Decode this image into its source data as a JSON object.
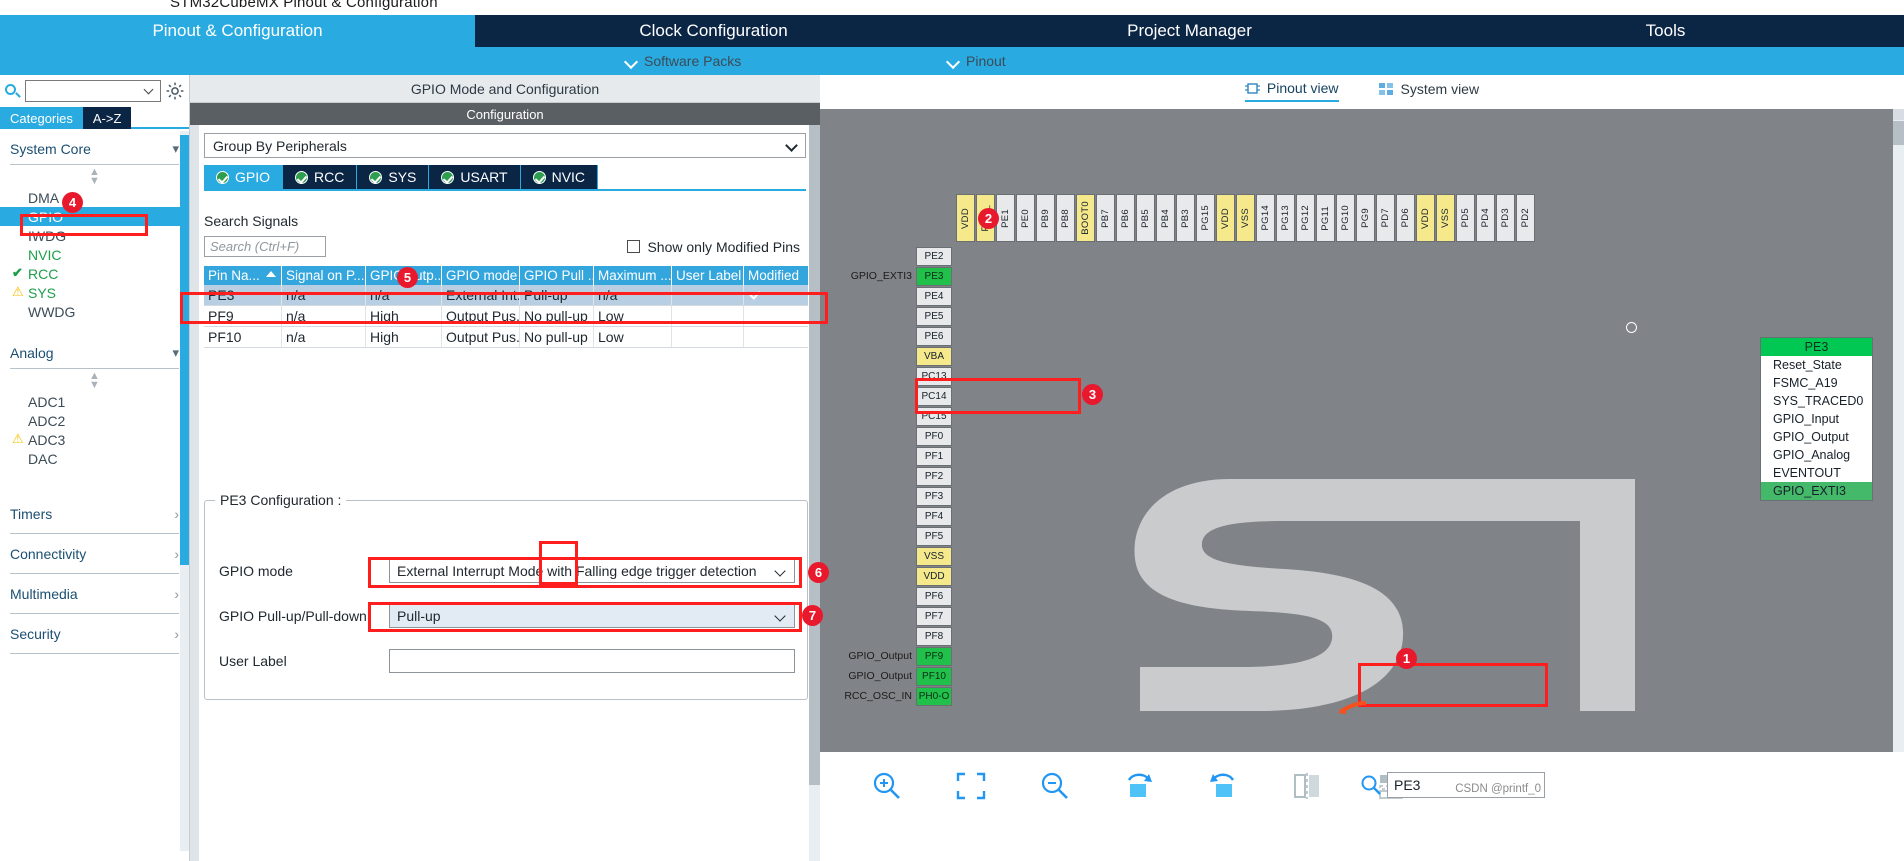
{
  "window": {
    "title_fragment": "STM32CubeMX Pinout & Configuration"
  },
  "main_tabs": [
    {
      "label": "Pinout & Configuration",
      "active": true
    },
    {
      "label": "Clock Configuration",
      "active": false
    },
    {
      "label": "Project Manager",
      "active": false
    },
    {
      "label": "Tools",
      "active": false
    }
  ],
  "sub_bar": {
    "software_packs": "Software Packs",
    "pinout": "Pinout",
    "chevron_icon": "chevron-down-icon"
  },
  "sidebar": {
    "search_placeholder": "",
    "search_icon": "search-icon",
    "settings_icon": "gear-icon",
    "tabs": [
      {
        "label": "Categories",
        "active": true
      },
      {
        "label": "A->Z",
        "active": false
      }
    ],
    "sections": [
      {
        "title": "System Core",
        "expanded": true,
        "items": [
          {
            "label": "DMA",
            "status": "none",
            "selected": false
          },
          {
            "label": "GPIO",
            "status": "none",
            "selected": true
          },
          {
            "label": "IWDG",
            "status": "none",
            "selected": false
          },
          {
            "label": "NVIC",
            "status": "configured",
            "selected": false
          },
          {
            "label": "RCC",
            "status": "ok",
            "selected": false
          },
          {
            "label": "SYS",
            "status": "warning",
            "selected": false
          },
          {
            "label": "WWDG",
            "status": "none",
            "selected": false
          }
        ]
      },
      {
        "title": "Analog",
        "expanded": true,
        "items": [
          {
            "label": "ADC1",
            "status": "none",
            "selected": false
          },
          {
            "label": "ADC2",
            "status": "none",
            "selected": false
          },
          {
            "label": "ADC3",
            "status": "warning",
            "selected": false
          },
          {
            "label": "DAC",
            "status": "none",
            "selected": false
          }
        ]
      }
    ],
    "collapsed_sections": [
      {
        "title": "Timers"
      },
      {
        "title": "Connectivity"
      },
      {
        "title": "Multimedia"
      },
      {
        "title": "Security"
      }
    ]
  },
  "config_panel": {
    "header": "GPIO Mode and Configuration",
    "sub_header": "Configuration",
    "group_by": "Group By Peripherals",
    "peripheral_tabs": [
      {
        "label": "GPIO",
        "active": true
      },
      {
        "label": "RCC",
        "active": false
      },
      {
        "label": "SYS",
        "active": false
      },
      {
        "label": "USART",
        "active": false
      },
      {
        "label": "NVIC",
        "active": false
      }
    ],
    "search_signals_label": "Search Signals",
    "search_placeholder": "Search (Ctrl+F)",
    "show_only_modified": "Show only Modified Pins",
    "show_only_modified_checked": false,
    "table": {
      "columns": [
        "Pin Na...",
        "Signal on P...",
        "GPIO outp...",
        "GPIO mode",
        "GPIO Pull ...",
        "Maximum ...",
        "User Label",
        "Modified"
      ],
      "sorted_column": 0,
      "rows": [
        {
          "pin": "PE3",
          "signal": "n/a",
          "output": "n/a",
          "mode": "External Int...",
          "pull": "Pull-up",
          "maximum": "n/a",
          "user_label": "",
          "modified": true,
          "selected": true
        },
        {
          "pin": "PF9",
          "signal": "n/a",
          "output": "High",
          "mode": "Output Pus...",
          "pull": "No pull-up ...",
          "maximum": "Low",
          "user_label": "",
          "modified": true,
          "selected": false
        },
        {
          "pin": "PF10",
          "signal": "n/a",
          "output": "High",
          "mode": "Output Pus...",
          "pull": "No pull-up ...",
          "maximum": "Low",
          "user_label": "",
          "modified": true,
          "selected": false
        }
      ]
    },
    "pin_config": {
      "legend": "PE3 Configuration :",
      "fields": [
        {
          "label": "GPIO mode",
          "value": "External Interrupt Mode with Falling edge trigger detection",
          "type": "select"
        },
        {
          "label": "GPIO Pull-up/Pull-down",
          "value": "Pull-up",
          "type": "select"
        },
        {
          "label": "User Label",
          "value": "",
          "type": "text"
        }
      ]
    }
  },
  "pinout_view": {
    "tabs": [
      {
        "label": "Pinout view",
        "icon": "pinout-view-icon",
        "active": true
      },
      {
        "label": "System view",
        "icon": "system-view-icon",
        "active": false
      }
    ],
    "top_pins": [
      "VDD",
      "PDR_",
      "PE1",
      "PE0",
      "PB9",
      "PB8",
      "BOOT0",
      "PB7",
      "PB6",
      "PB5",
      "PB4",
      "PB3",
      "PG15",
      "VDD",
      "VSS",
      "PG14",
      "PG13",
      "PG12",
      "PG11",
      "PG10",
      "PG9",
      "PD7",
      "PD6",
      "VDD",
      "VSS",
      "PD5",
      "PD4",
      "PD3",
      "PD2"
    ],
    "left_pins": [
      {
        "name": "PE2",
        "label": "",
        "highlight": "none"
      },
      {
        "name": "PE3",
        "label": "GPIO_EXTI3",
        "highlight": "green"
      },
      {
        "name": "PE4",
        "label": "",
        "highlight": "none"
      },
      {
        "name": "PE5",
        "label": "",
        "highlight": "none"
      },
      {
        "name": "PE6",
        "label": "",
        "highlight": "none"
      },
      {
        "name": "VBA",
        "label": "",
        "highlight": "power"
      },
      {
        "name": "PC13",
        "label": "",
        "highlight": "none"
      },
      {
        "name": "PC14",
        "label": "",
        "highlight": "none"
      },
      {
        "name": "PC15",
        "label": "",
        "highlight": "none"
      },
      {
        "name": "PF0",
        "label": "",
        "highlight": "none"
      },
      {
        "name": "PF1",
        "label": "",
        "highlight": "none"
      },
      {
        "name": "PF2",
        "label": "",
        "highlight": "none"
      },
      {
        "name": "PF3",
        "label": "",
        "highlight": "none"
      },
      {
        "name": "PF4",
        "label": "",
        "highlight": "none"
      },
      {
        "name": "PF5",
        "label": "",
        "highlight": "none"
      },
      {
        "name": "VSS",
        "label": "",
        "highlight": "power"
      },
      {
        "name": "VDD",
        "label": "",
        "highlight": "power"
      },
      {
        "name": "PF6",
        "label": "",
        "highlight": "none"
      },
      {
        "name": "PF7",
        "label": "",
        "highlight": "none"
      },
      {
        "name": "PF8",
        "label": "",
        "highlight": "none"
      },
      {
        "name": "PF9",
        "label": "GPIO_Output",
        "highlight": "green"
      },
      {
        "name": "PF10",
        "label": "GPIO_Output",
        "highlight": "green"
      },
      {
        "name": "PH0-O",
        "label": "RCC_OSC_IN",
        "highlight": "green"
      }
    ],
    "pin_menu": {
      "pin": "PE3",
      "items": [
        {
          "label": "Reset_State",
          "selected": false
        },
        {
          "label": "FSMC_A19",
          "selected": false
        },
        {
          "label": "SYS_TRACED0",
          "selected": false
        },
        {
          "label": "GPIO_Input",
          "selected": false
        },
        {
          "label": "GPIO_Output",
          "selected": false
        },
        {
          "label": "GPIO_Analog",
          "selected": false
        },
        {
          "label": "EVENTOUT",
          "selected": false
        },
        {
          "label": "GPIO_EXTI3",
          "selected": true
        }
      ]
    },
    "toolbar_icons": [
      "zoom-in-icon",
      "fit-to-screen-icon",
      "zoom-out-icon",
      "rotate-left-icon",
      "rotate-right-icon",
      "flip-horizontal-icon",
      "layout-icon"
    ],
    "pin_search": {
      "icon": "search-icon",
      "value": "PE3",
      "watermark": "CSDN @printf_0"
    }
  },
  "annotations": [
    {
      "number": "1",
      "target": "pin-search-box"
    },
    {
      "number": "2",
      "target": "pe3-pin-chip"
    },
    {
      "number": "3",
      "target": "gpio-exti3-menu-item"
    },
    {
      "number": "4",
      "target": "sidebar-gpio"
    },
    {
      "number": "5",
      "target": "pe3-table-row"
    },
    {
      "number": "6",
      "target": "gpio-mode-select"
    },
    {
      "number": "7",
      "target": "gpio-pull-select"
    }
  ],
  "colors": {
    "accent": "#29ABE2",
    "dark_nav": "#0b2545",
    "green": "#21C04B",
    "annotation_red": "#FF1E1E",
    "power_yellow": "#F5E98C"
  }
}
